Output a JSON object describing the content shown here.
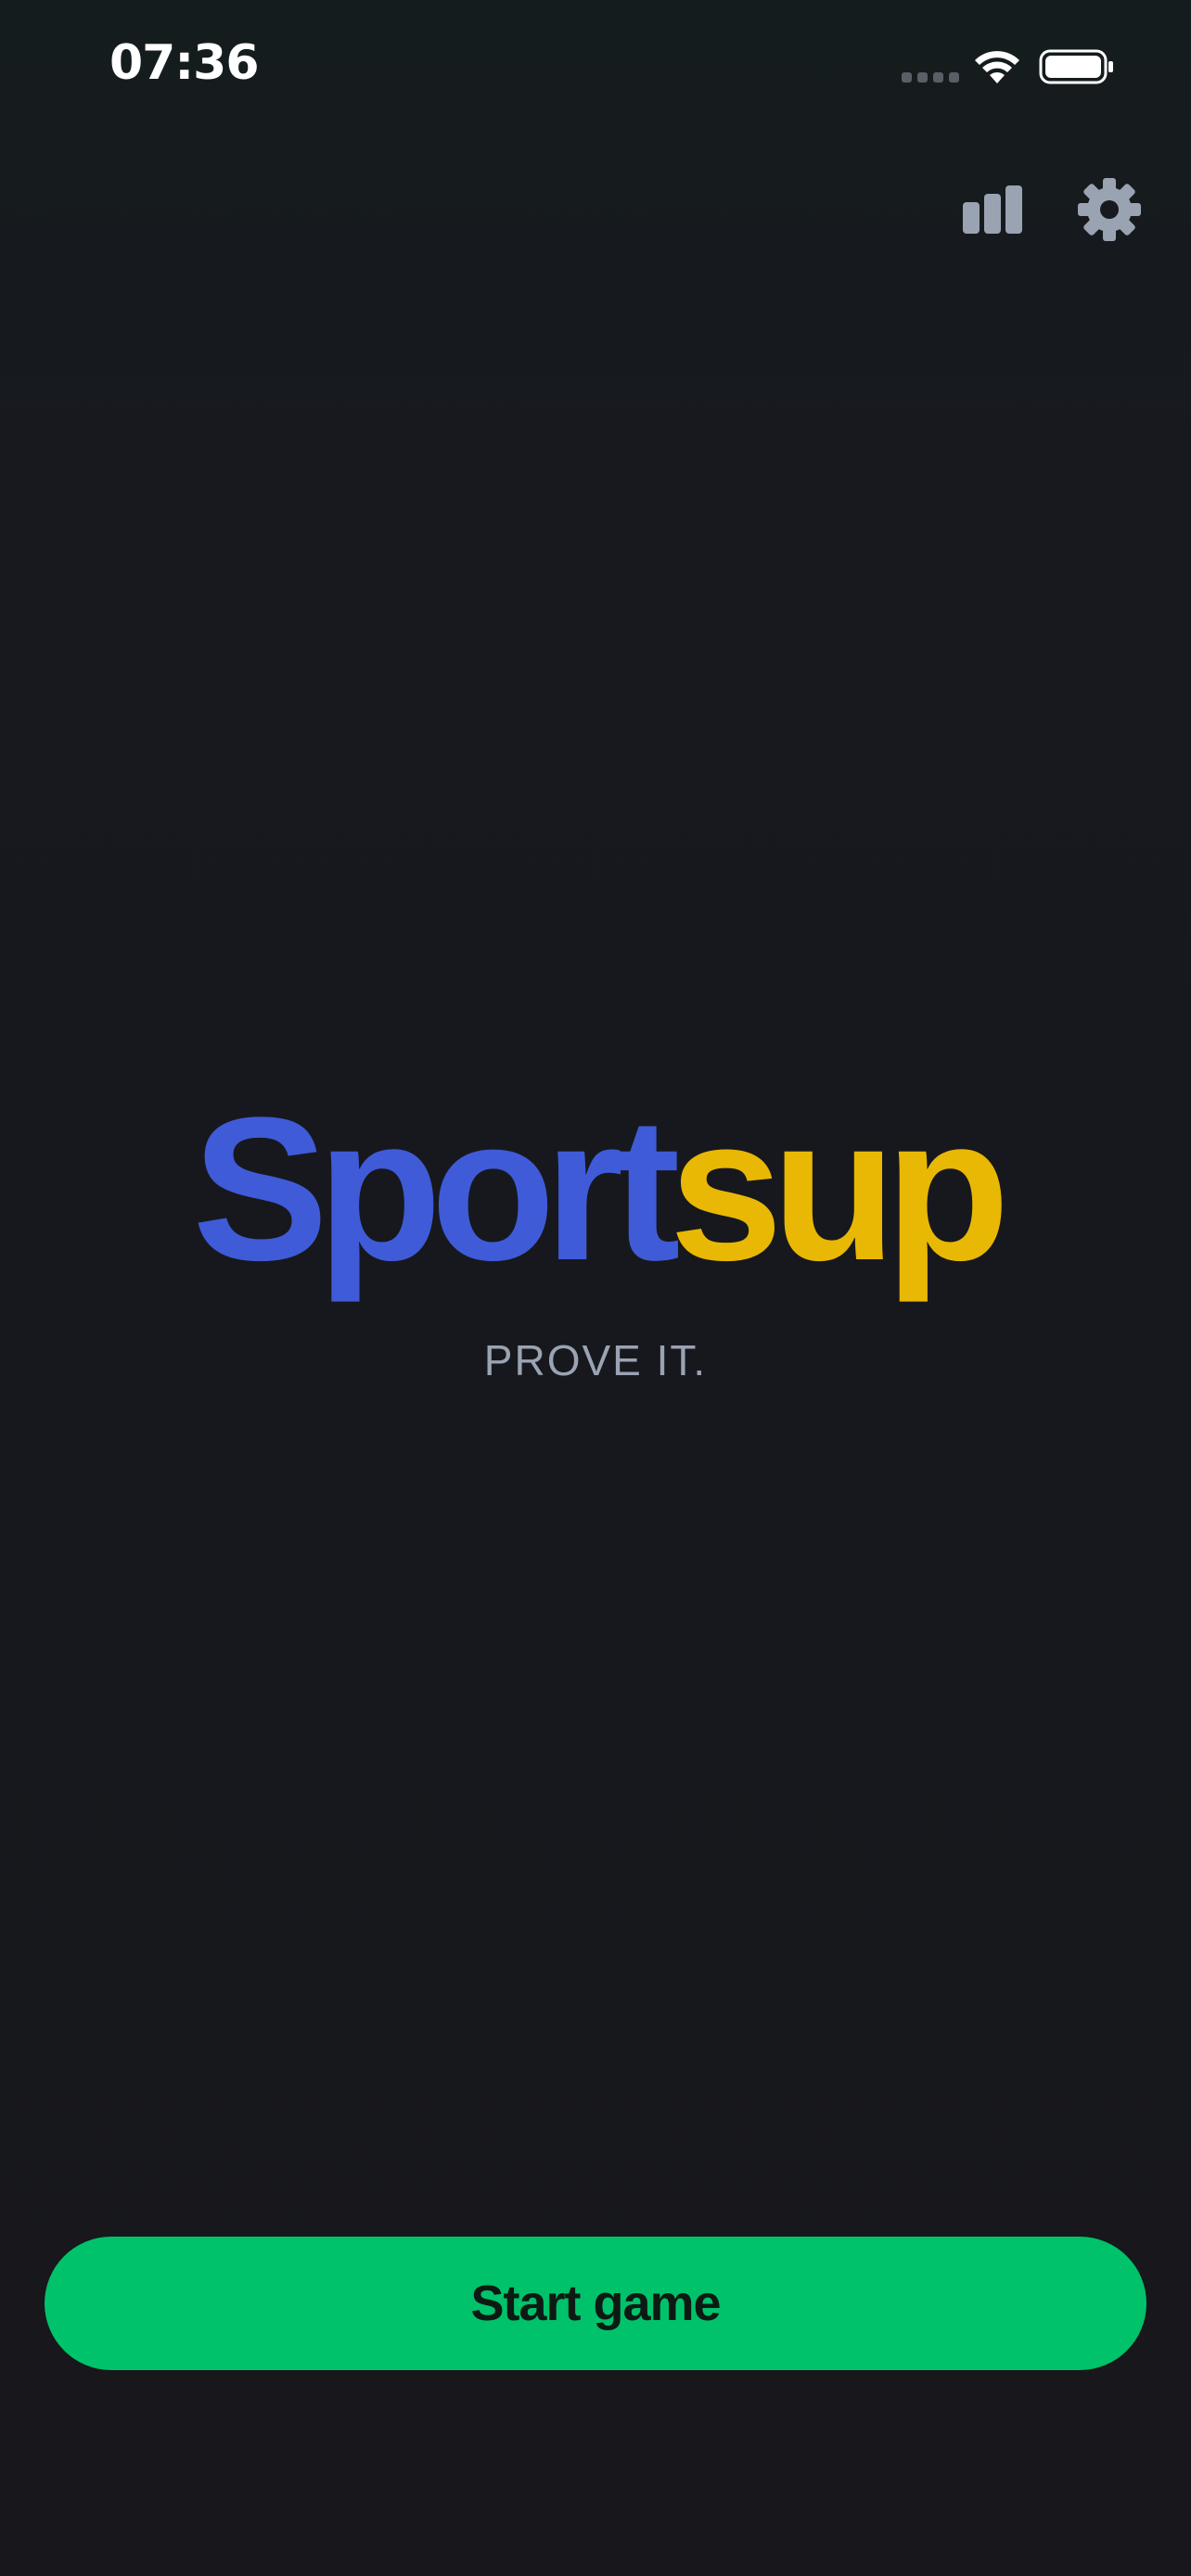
{
  "status_bar": {
    "time": "07:36"
  },
  "toolbar": {
    "stats_icon": "bar-chart-icon",
    "settings_icon": "gear-icon"
  },
  "logo": {
    "part_a": "Sport",
    "part_b": "sup",
    "color_a": "#3f5bd8",
    "color_b": "#e8b804"
  },
  "tagline": "PROVE IT.",
  "start_button": {
    "label": "Start game",
    "color": "#00c26a"
  }
}
